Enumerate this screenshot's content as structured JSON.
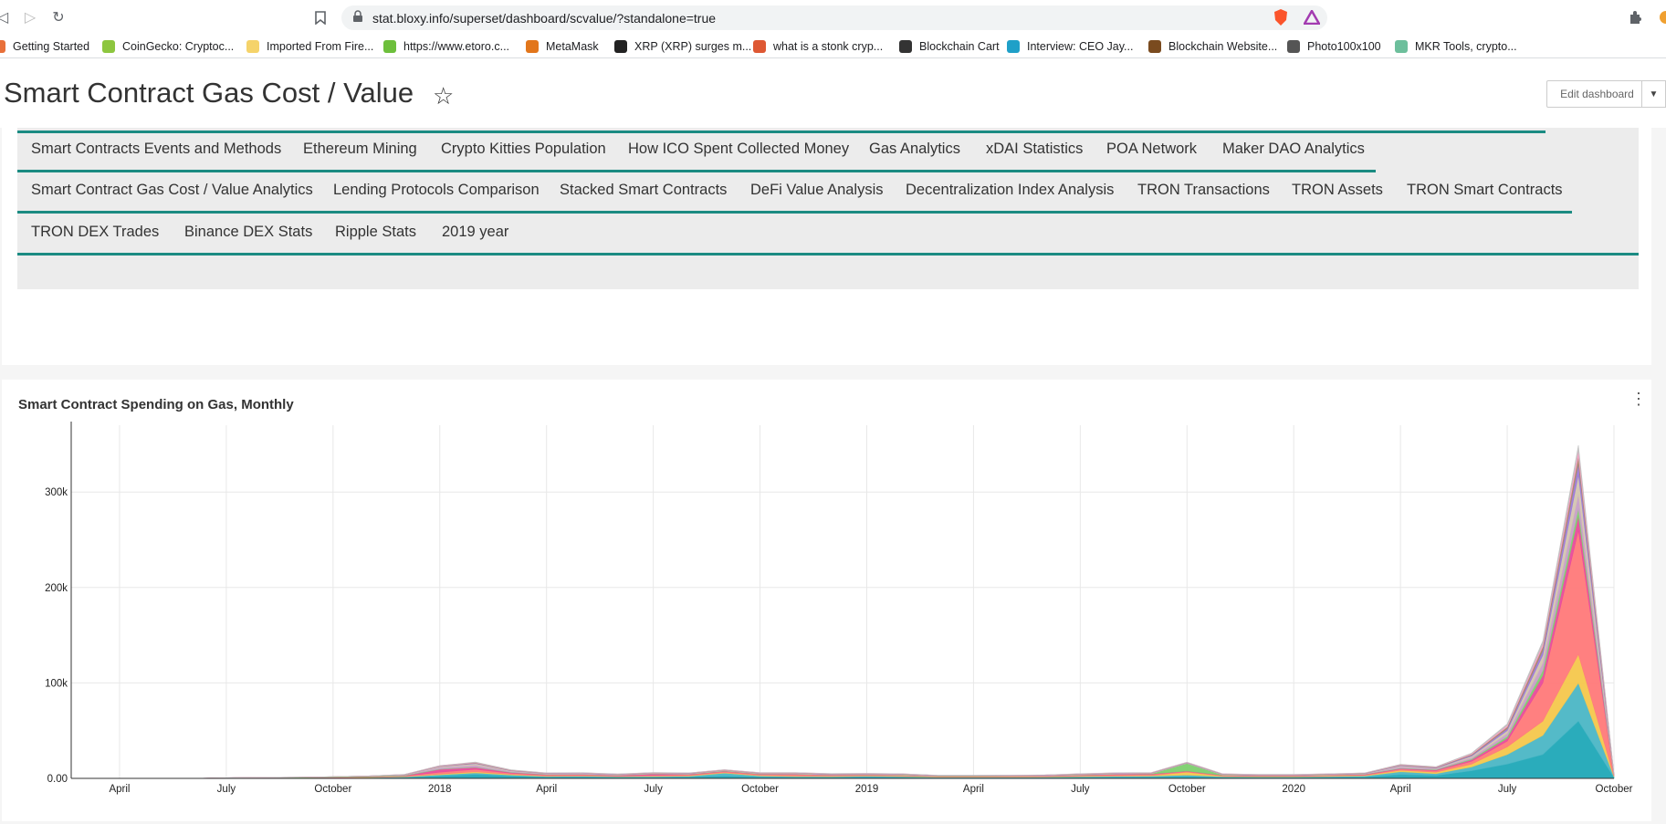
{
  "browser": {
    "url": "stat.bloxy.info/superset/dashboard/scvalue/?standalone=true",
    "bookmarks": [
      {
        "label": "Getting Started",
        "color": "#e8703a"
      },
      {
        "label": "CoinGecko: Cryptoc...",
        "color": "#8dc63f"
      },
      {
        "label": "Imported From Fire...",
        "color": "#f5d36a"
      },
      {
        "label": "https://www.etoro.c...",
        "color": "#6dbf3c"
      },
      {
        "label": "MetaMask",
        "color": "#e2761b"
      },
      {
        "label": "XRP (XRP) surges m...",
        "color": "#222222"
      },
      {
        "label": "what is a stonk cryp...",
        "color": "#de5833"
      },
      {
        "label": "Blockchain Cart",
        "color": "#333333"
      },
      {
        "label": "Interview: CEO Jay...",
        "color": "#1fa0c8"
      },
      {
        "label": "Blockchain Website...",
        "color": "#7a4b1f"
      },
      {
        "label": "Photo100x100",
        "color": "#555555"
      },
      {
        "label": "MKR Tools, crypto...",
        "color": "#6dbf9c"
      }
    ]
  },
  "dashboard": {
    "title": "Smart Contract Gas Cost / Value",
    "edit_label": "Edit dashboard",
    "nav_rows": [
      [
        "Smart Contracts Events and Methods",
        "Ethereum Mining",
        "Crypto Kitties Population",
        "How ICO Spent Collected Money",
        "Gas Analytics",
        "xDAI Statistics",
        "POA Network",
        "Maker DAO Analytics"
      ],
      [
        "Smart Contract Gas Cost / Value Analytics",
        "Lending Protocols Comparison",
        "Stacked Smart Contracts",
        "DeFi Value Analysis",
        "Decentralization Index Analysis",
        "TRON Transactions",
        "TRON Assets",
        "TRON Smart Contracts"
      ],
      [
        "TRON DEX Trades",
        "Binance DEX Stats",
        "Ripple Stats",
        "2019 year"
      ]
    ]
  },
  "chart_data": {
    "type": "area",
    "title": "Smart Contract Spending on Gas, Monthly",
    "xlabel": "",
    "ylabel": "",
    "ylim": [
      0,
      370000
    ],
    "y_ticks": [
      "0.00",
      "100k",
      "200k",
      "300k"
    ],
    "x_tick_labels": [
      "April",
      "July",
      "October",
      "2018",
      "April",
      "July",
      "October",
      "2019",
      "April",
      "July",
      "October",
      "2020",
      "April",
      "July",
      "October"
    ],
    "x": [
      "2017-03",
      "2017-04",
      "2017-05",
      "2017-06",
      "2017-07",
      "2017-08",
      "2017-09",
      "2017-10",
      "2017-11",
      "2017-12",
      "2018-01",
      "2018-02",
      "2018-03",
      "2018-04",
      "2018-05",
      "2018-06",
      "2018-07",
      "2018-08",
      "2018-09",
      "2018-10",
      "2018-11",
      "2018-12",
      "2019-01",
      "2019-02",
      "2019-03",
      "2019-04",
      "2019-05",
      "2019-06",
      "2019-07",
      "2019-08",
      "2019-09",
      "2019-10",
      "2019-11",
      "2019-12",
      "2020-01",
      "2020-02",
      "2020-03",
      "2020-04",
      "2020-05",
      "2020-06",
      "2020-07",
      "2020-08",
      "2020-09",
      "2020-10"
    ],
    "series": [
      {
        "color": "#1fa8b8",
        "values": [
          0,
          0,
          0,
          0,
          200,
          300,
          300,
          400,
          600,
          1000,
          2500,
          4000,
          2500,
          1500,
          1500,
          1200,
          1200,
          1500,
          2500,
          1500,
          1200,
          1200,
          1500,
          1300,
          800,
          800,
          800,
          900,
          1200,
          1300,
          1400,
          2000,
          1200,
          1000,
          1000,
          1200,
          1500,
          4000,
          3000,
          8000,
          15000,
          25000,
          60000,
          1000
        ]
      },
      {
        "color": "#4bb7c6",
        "values": [
          0,
          0,
          0,
          0,
          100,
          200,
          200,
          200,
          300,
          600,
          1200,
          1800,
          1000,
          600,
          800,
          600,
          800,
          800,
          3000,
          1000,
          800,
          700,
          800,
          700,
          500,
          500,
          500,
          500,
          700,
          900,
          1000,
          1500,
          700,
          600,
          600,
          800,
          1000,
          3000,
          2000,
          4000,
          10000,
          20000,
          40000,
          800
        ]
      },
      {
        "color": "#f5c84c",
        "values": [
          0,
          0,
          0,
          0,
          100,
          100,
          100,
          200,
          200,
          300,
          800,
          1200,
          700,
          500,
          500,
          400,
          500,
          600,
          700,
          600,
          500,
          500,
          500,
          500,
          400,
          400,
          400,
          400,
          500,
          600,
          600,
          3000,
          500,
          500,
          500,
          600,
          700,
          1500,
          1500,
          3000,
          8000,
          15000,
          30000,
          600
        ]
      },
      {
        "color": "#ff7a7a",
        "values": [
          0,
          0,
          0,
          0,
          50,
          50,
          100,
          200,
          300,
          500,
          2000,
          2500,
          1200,
          800,
          800,
          500,
          600,
          800,
          1000,
          1000,
          1500,
          800,
          600,
          500,
          400,
          400,
          400,
          400,
          600,
          1000,
          1200,
          800,
          600,
          500,
          500,
          500,
          600,
          1200,
          1500,
          3000,
          6000,
          40000,
          130000,
          500
        ]
      },
      {
        "color": "#e84a9b",
        "values": [
          0,
          0,
          0,
          0,
          50,
          100,
          100,
          100,
          200,
          300,
          3000,
          2000,
          800,
          500,
          500,
          400,
          1500,
          500,
          400,
          400,
          300,
          300,
          300,
          300,
          200,
          200,
          300,
          300,
          400,
          500,
          400,
          400,
          300,
          300,
          300,
          300,
          400,
          600,
          800,
          1500,
          3000,
          8000,
          15000,
          400
        ]
      },
      {
        "color": "#7ed06e",
        "values": [
          0,
          0,
          0,
          0,
          100,
          200,
          300,
          500,
          600,
          500,
          400,
          400,
          300,
          300,
          300,
          300,
          300,
          300,
          300,
          300,
          300,
          300,
          300,
          300,
          200,
          200,
          200,
          200,
          300,
          300,
          300,
          8000,
          300,
          200,
          200,
          200,
          300,
          400,
          500,
          800,
          2000,
          5000,
          8000,
          300
        ]
      },
      {
        "color": "#c8a0c8",
        "values": [
          0,
          0,
          0,
          0,
          50,
          50,
          100,
          100,
          200,
          300,
          1500,
          2000,
          800,
          500,
          500,
          300,
          300,
          300,
          300,
          300,
          500,
          300,
          300,
          300,
          200,
          200,
          200,
          300,
          300,
          300,
          300,
          300,
          300,
          200,
          200,
          300,
          300,
          1500,
          800,
          1500,
          3000,
          8000,
          15000,
          300
        ]
      },
      {
        "color": "#d4c6b0",
        "values": [
          0,
          0,
          0,
          0,
          50,
          50,
          100,
          100,
          200,
          300,
          1000,
          1500,
          600,
          400,
          400,
          300,
          300,
          300,
          300,
          300,
          300,
          300,
          300,
          300,
          200,
          200,
          200,
          300,
          300,
          300,
          300,
          300,
          300,
          200,
          200,
          300,
          300,
          1000,
          600,
          1500,
          3000,
          8000,
          20000,
          300
        ]
      },
      {
        "color": "#9c7bd9",
        "values": [
          0,
          0,
          0,
          0,
          0,
          0,
          0,
          0,
          0,
          100,
          300,
          500,
          300,
          200,
          200,
          200,
          200,
          200,
          200,
          200,
          200,
          200,
          200,
          200,
          100,
          100,
          100,
          100,
          200,
          200,
          200,
          200,
          200,
          200,
          200,
          200,
          200,
          500,
          500,
          1000,
          2000,
          5000,
          12000,
          200
        ]
      },
      {
        "color": "#a88a6a",
        "values": [
          0,
          0,
          0,
          0,
          0,
          0,
          0,
          0,
          0,
          100,
          300,
          500,
          300,
          200,
          200,
          200,
          200,
          200,
          200,
          200,
          200,
          200,
          200,
          200,
          100,
          100,
          100,
          100,
          200,
          200,
          200,
          200,
          200,
          200,
          200,
          200,
          200,
          400,
          400,
          800,
          2000,
          4000,
          8000,
          200
        ]
      },
      {
        "color": "#ff9ec8",
        "values": [
          0,
          0,
          0,
          0,
          0,
          0,
          0,
          0,
          0,
          100,
          300,
          400,
          300,
          200,
          200,
          200,
          200,
          200,
          200,
          200,
          200,
          200,
          200,
          200,
          100,
          100,
          100,
          100,
          200,
          200,
          200,
          200,
          200,
          200,
          200,
          200,
          200,
          400,
          400,
          800,
          1500,
          3000,
          6000,
          200
        ]
      },
      {
        "color": "#c0c0c0",
        "values": [
          0,
          0,
          0,
          0,
          0,
          0,
          0,
          0,
          0,
          100,
          200,
          300,
          200,
          100,
          100,
          100,
          100,
          100,
          100,
          100,
          100,
          100,
          100,
          100,
          100,
          100,
          100,
          100,
          100,
          100,
          100,
          100,
          100,
          100,
          100,
          100,
          100,
          300,
          300,
          600,
          1500,
          3000,
          5000,
          100
        ]
      }
    ]
  }
}
